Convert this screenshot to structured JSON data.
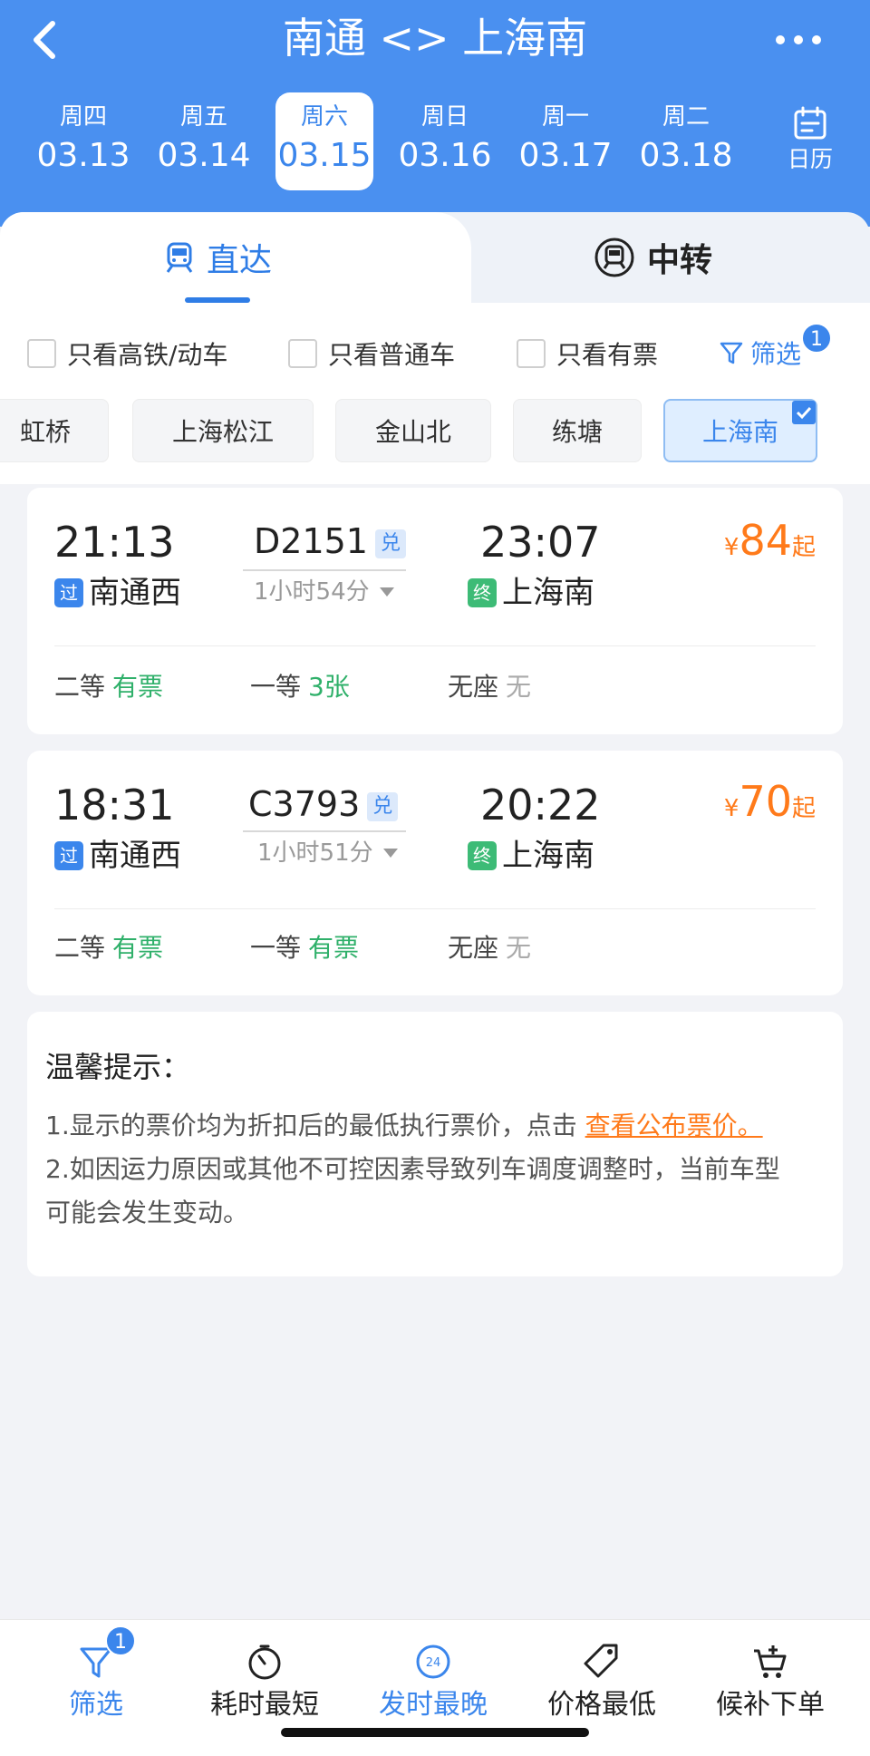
{
  "header": {
    "title": "南通 <> 上海南",
    "dates": [
      {
        "weekday": "周四",
        "date": "03.13",
        "active": false
      },
      {
        "weekday": "周五",
        "date": "03.14",
        "active": false
      },
      {
        "weekday": "周六",
        "date": "03.15",
        "active": true
      },
      {
        "weekday": "周日",
        "date": "03.16",
        "active": false
      },
      {
        "weekday": "周一",
        "date": "03.17",
        "active": false
      },
      {
        "weekday": "周二",
        "date": "03.18",
        "active": false
      }
    ],
    "calendar_label": "日历"
  },
  "tabs": {
    "direct": "直达",
    "transfer": "中转"
  },
  "filters": {
    "checks": [
      "只看高铁/动车",
      "只看普通车",
      "只看有票"
    ],
    "filter_label": "筛选",
    "filter_count": "1"
  },
  "stations": [
    "虹桥",
    "上海松江",
    "金山北",
    "练塘",
    "上海南"
  ],
  "trains": [
    {
      "dep_time": "21:13",
      "train_no": "D2151",
      "exchange": "兑",
      "arr_time": "23:07",
      "duration": "1小时54分",
      "dep_tag": "过",
      "dep_station": "南通西",
      "arr_tag": "终",
      "arr_station": "上海南",
      "price_symbol": "¥",
      "price": "84",
      "price_suffix": "起",
      "seats": [
        {
          "cls": "二等",
          "status": "有票"
        },
        {
          "cls": "一等",
          "status": "3张"
        },
        {
          "cls": "无座",
          "status": "无"
        }
      ]
    },
    {
      "dep_time": "18:31",
      "train_no": "C3793",
      "exchange": "兑",
      "arr_time": "20:22",
      "duration": "1小时51分",
      "dep_tag": "过",
      "dep_station": "南通西",
      "arr_tag": "终",
      "arr_station": "上海南",
      "price_symbol": "¥",
      "price": "70",
      "price_suffix": "起",
      "seats": [
        {
          "cls": "二等",
          "status": "有票"
        },
        {
          "cls": "一等",
          "status": "有票"
        },
        {
          "cls": "无座",
          "status": "无"
        }
      ]
    }
  ],
  "notice": {
    "title": "温馨提示：",
    "line1": "1.显示的票价均为折扣后的最低执行票价，点击 ",
    "line1_link": "查看公布票价。",
    "line2": "2.如因运力原因或其他不可控因素导致列车调度调整时，当前车型",
    "line3": "可能会发生变动。"
  },
  "bottom_bar": {
    "filter": "筛选",
    "filter_badge": "1",
    "shortest": "耗时最短",
    "latest": "发时最晚",
    "latest_icon_text": "24",
    "cheapest": "价格最低",
    "waitlist": "候补下单"
  },
  "colors": {
    "brand_blue": "#4a90f0",
    "price_orange": "#ff7a1a",
    "available_green": "#2fb06a"
  }
}
